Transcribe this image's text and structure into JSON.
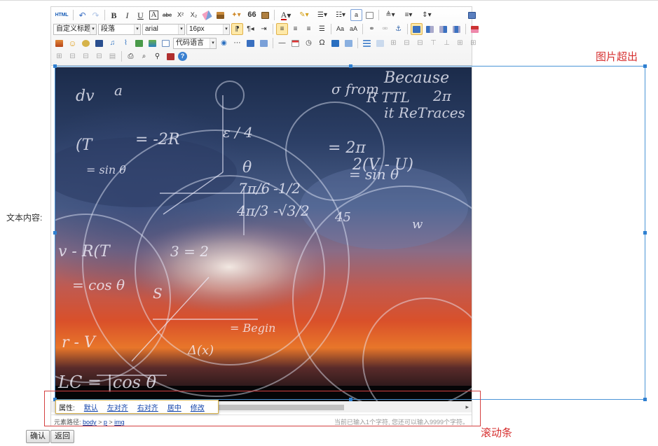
{
  "form": {
    "field_label": "文本内容:",
    "confirm_button": "确认",
    "back_button": "返回"
  },
  "toolbar": {
    "html_label": "HTML",
    "heading_select": "自定义标题",
    "paragraph_select": "段落",
    "font_family_select": "arial",
    "font_size_select": "16px",
    "code_language_select": "代码语言",
    "bold": "B",
    "italic": "I",
    "underline": "U",
    "font_border": "A",
    "strikethrough": "abc",
    "superscript": "X²",
    "subscript": "X₂",
    "blockquote": "66",
    "font_color": "A",
    "omega": "Ω"
  },
  "image_popup": {
    "label": "属性:",
    "links": [
      "默认",
      "左对齐",
      "右对齐",
      "居中",
      "修改"
    ]
  },
  "statusbar": {
    "path_label": "元素路径:",
    "path_items": [
      "body",
      "p",
      "img"
    ],
    "path_separator": ">",
    "count_text": "当前已输入1个字符, 您还可以输入9999个字符。"
  },
  "annotations": {
    "image_overflow": "图片超出",
    "scrollbar": "滚动条"
  },
  "colors": {
    "annotation_red": "#d62f2f",
    "selection_blue": "#2f80d1",
    "active_button": "#ffe9a8"
  }
}
